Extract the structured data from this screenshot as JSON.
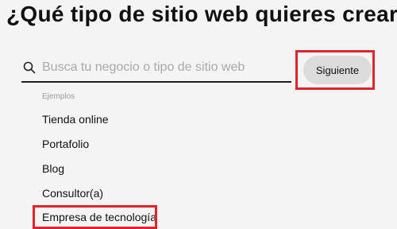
{
  "page": {
    "heading": "¿Qué tipo de sitio web quieres crear?"
  },
  "search": {
    "placeholder": "Busca tu negocio o tipo de sitio web",
    "value": ""
  },
  "next_button": {
    "label": "Siguiente"
  },
  "examples": {
    "label": "Ejemplos",
    "items": [
      "Tienda online",
      "Portafolio",
      "Blog",
      "Consultor(a)",
      "Empresa de tecnología"
    ]
  },
  "colors": {
    "highlight": "#e0242b",
    "button_bg": "#dcdcdc",
    "page_bg": "#f4f4f4"
  }
}
